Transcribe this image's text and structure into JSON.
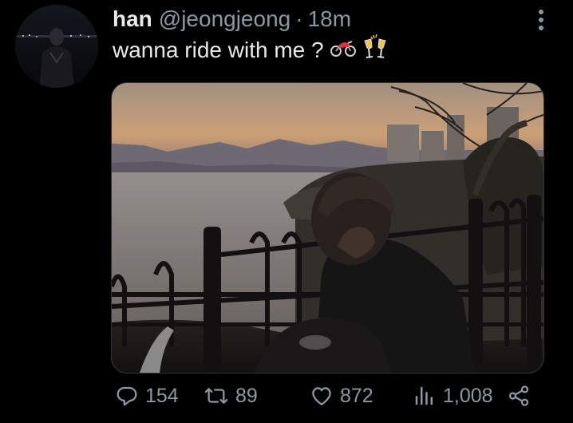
{
  "tweet": {
    "author_name": "han",
    "author_handle": "@jeongjeong",
    "separator": "·",
    "timestamp": "18m",
    "text": "wanna ride with me ?",
    "emojis": [
      "motorcycle-emoji",
      "clinking-glasses-emoji"
    ]
  },
  "stats": {
    "replies": "154",
    "retweets": "89",
    "likes": "872",
    "views": "1,008"
  },
  "icons": {
    "more": "more-vertical-icon",
    "reply": "reply-icon",
    "retweet": "retweet-icon",
    "like": "heart-icon",
    "views": "views-chart-icon",
    "share": "share-icon"
  },
  "colors": {
    "background": "#000000",
    "text_primary": "#e7e9ea",
    "text_secondary": "#8b98a5"
  }
}
